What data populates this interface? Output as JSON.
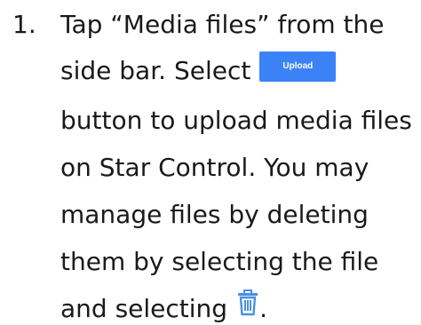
{
  "step": {
    "number": "1.",
    "line1": "Tap “Media files” from the",
    "line2": "side bar. Select",
    "upload_button_label": "Upload",
    "line3": "button to upload media files",
    "line4": "on Star Control. You may",
    "line5": "manage files by deleting",
    "line6": "them by selecting the file",
    "line7": "and selecting",
    "line7_end": ".",
    "trash_icon": "trash-icon"
  },
  "colors": {
    "upload_button": "#3b82f6",
    "trash_icon": "#4a90e2",
    "text": "#1a1a1a"
  }
}
